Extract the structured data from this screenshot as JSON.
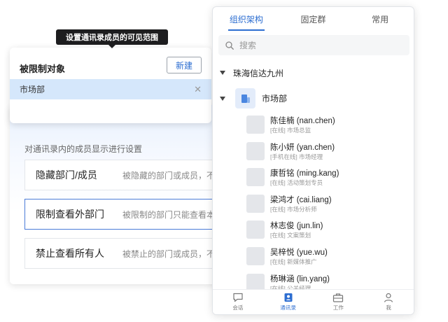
{
  "tooltip": {
    "text": "设置通讯录成员的可见范围"
  },
  "dialog": {
    "title": "被限制对象",
    "new_button_label": "新建",
    "selected_item": "市场部"
  },
  "settings": {
    "description": "对通讯录内的成员显示进行设置",
    "options": [
      {
        "title": "隐藏部门/成员",
        "desc": "被隐藏的部门或成员，不"
      },
      {
        "title": "限制查看外部门",
        "desc": "被限制的部门只能查看本"
      },
      {
        "title": "禁止查看所有人",
        "desc": "被禁止的部门或成员，不"
      }
    ],
    "active_index": 1
  },
  "contacts_app": {
    "tabs": [
      "组织架构",
      "固定群",
      "常用"
    ],
    "active_tab": 0,
    "search": {
      "placeholder": "搜索",
      "value": ""
    },
    "root_org": "珠海信达九州",
    "department": "市场部",
    "members": [
      {
        "name": "陈佳楠 (nan.chen)",
        "status": "[在线] 市场总监"
      },
      {
        "name": "陈小妍 (yan.chen)",
        "status": "[手机在线] 市场经理"
      },
      {
        "name": "康哲铭 (ming.kang)",
        "status": "[在线] 活动策划专员"
      },
      {
        "name": "梁鸿才 (cai.liang)",
        "status": "[在线] 市场分析师"
      },
      {
        "name": "林志俊 (jun.lin)",
        "status": "[在线] 文案策划"
      },
      {
        "name": "吴梓悦 (yue.wu)",
        "status": "[在线] 新媒体推广"
      },
      {
        "name": "杨琳涵 (lin.yang)",
        "status": "[在线] 公关经理"
      }
    ],
    "bottom_nav": [
      {
        "label": "会话",
        "icon": "chat-icon"
      },
      {
        "label": "通讯录",
        "icon": "contacts-icon"
      },
      {
        "label": "工作",
        "icon": "briefcase-icon"
      },
      {
        "label": "我",
        "icon": "person-icon"
      }
    ],
    "active_nav": 1
  },
  "colors": {
    "accent": "#2d6ed1",
    "selected_bg": "#d5e7fb",
    "tooltip_bg": "#1d1d1f"
  }
}
